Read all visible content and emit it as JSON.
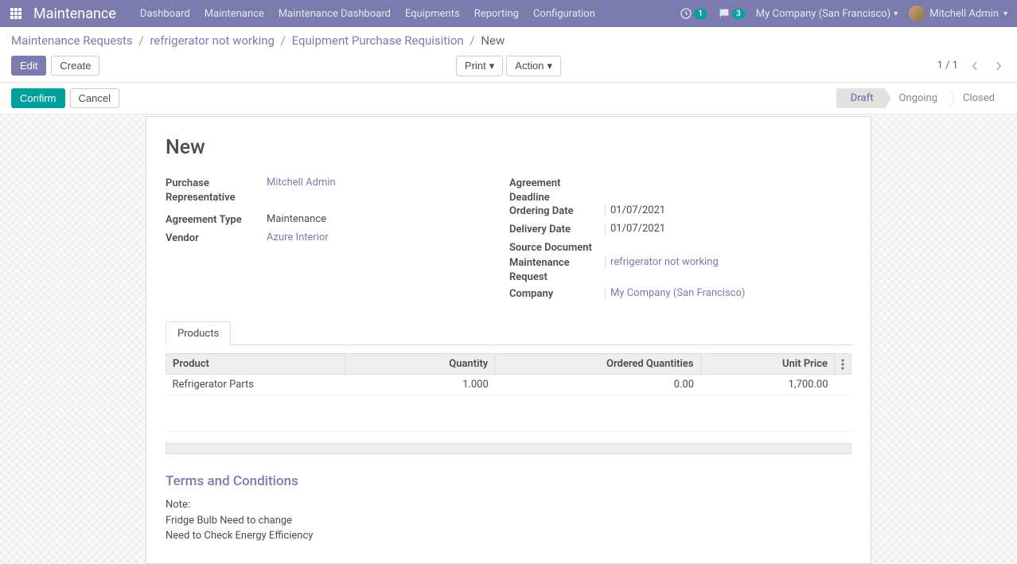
{
  "navbar": {
    "brand": "Maintenance",
    "menu": [
      "Dashboard",
      "Maintenance",
      "Maintenance Dashboard",
      "Equipments",
      "Reporting",
      "Configuration"
    ],
    "activity_count": "1",
    "messages_count": "3",
    "company": "My Company (San Francisco)",
    "user": "Mitchell Admin"
  },
  "breadcrumb": {
    "items": [
      "Maintenance Requests",
      "refrigerator not working",
      "Equipment Purchase Requisition"
    ],
    "current": "New"
  },
  "buttons": {
    "edit": "Edit",
    "create": "Create",
    "print": "Print",
    "action": "Action",
    "confirm": "Confirm",
    "cancel": "Cancel"
  },
  "pager": {
    "text": "1 / 1"
  },
  "status": {
    "steps": [
      "Draft",
      "Ongoing",
      "Closed"
    ],
    "active": 0
  },
  "form": {
    "title": "New",
    "left": {
      "purchase_rep_label": "Purchase Representative",
      "purchase_rep_value": "Mitchell Admin",
      "agreement_type_label": "Agreement Type",
      "agreement_type_value": "Maintenance",
      "vendor_label": "Vendor",
      "vendor_value": "Azure Interior"
    },
    "right": {
      "deadline_label": "Agreement Deadline",
      "ordering_date_label": "Ordering Date",
      "ordering_date_value": "01/07/2021",
      "delivery_date_label": "Delivery Date",
      "delivery_date_value": "01/07/2021",
      "source_doc_label": "Source Document",
      "maint_req_label": "Maintenance Request",
      "maint_req_value": "refrigerator not working",
      "company_label": "Company",
      "company_value": "My Company (San Francisco)"
    }
  },
  "tabs": {
    "products": "Products"
  },
  "table": {
    "headers": {
      "product": "Product",
      "quantity": "Quantity",
      "ordered": "Ordered Quantities",
      "unit_price": "Unit Price"
    },
    "rows": [
      {
        "product": "Refrigerator Parts",
        "quantity": "1.000",
        "ordered": "0.00",
        "unit_price": "1,700.00"
      }
    ]
  },
  "terms": {
    "heading": "Terms and Conditions",
    "body": "Note:\nFridge Bulb Need to change\nNeed to Check Energy Efficiency"
  }
}
